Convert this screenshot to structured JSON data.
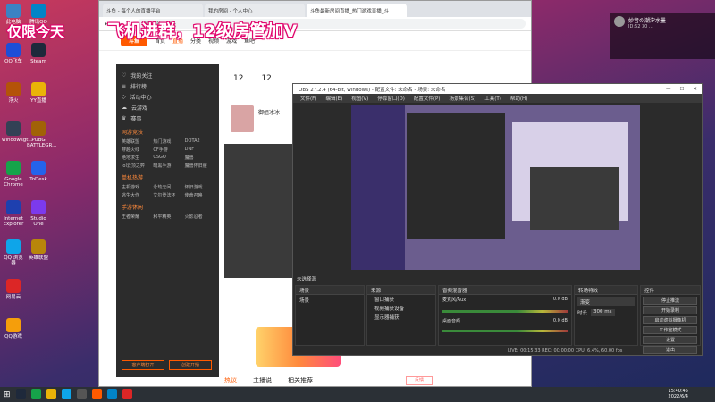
{
  "overlay": {
    "banner_left": "仅限今天",
    "banner_main": "飞机进群，12级房管加V"
  },
  "desktop_icons": [
    {
      "label": "此电脑",
      "color": "#3b82c4"
    },
    {
      "label": "QQ飞车",
      "color": "#1d4ed8"
    },
    {
      "label": "浮火",
      "color": "#b45309"
    },
    {
      "label": "windowsgt...",
      "color": "#334155"
    },
    {
      "label": "Google Chrome",
      "color": "#16a34a"
    },
    {
      "label": "Internet Explorer",
      "color": "#1e40af"
    },
    {
      "label": "QQ 浏览器",
      "color": "#0ea5e9"
    },
    {
      "label": "网易云",
      "color": "#dc2626"
    },
    {
      "label": "QQ游戏",
      "color": "#f59e0b"
    }
  ],
  "desktop_icons_col2": [
    {
      "label": "腾讯QQ",
      "color": "#0284c7"
    },
    {
      "label": "Steam",
      "color": "#1e293b"
    },
    {
      "label": "YY直播",
      "color": "#eab308"
    },
    {
      "label": "PUBG BATTLEGR...",
      "color": "#a16207"
    },
    {
      "label": "ToDesk",
      "color": "#2563eb"
    },
    {
      "label": "Studio One",
      "color": "#7c3aed"
    },
    {
      "label": "英雄联盟",
      "color": "#b8860b"
    }
  ],
  "browser": {
    "tabs": [
      "斗鱼 - 每个人的直播平台",
      "我的房间 - 个人中心",
      "斗鱼最新房间直播_热门游戏直播_斗"
    ],
    "address": "搜索或输入网址",
    "nav": [
      "首页",
      "直播",
      "分类",
      "视频",
      "游戏",
      "鱼吧"
    ],
    "logo": "斗鱼",
    "sidebar_items": [
      "我的关注",
      "排行榜",
      "活动中心",
      "云游戏",
      "赛事"
    ],
    "sidebar_section1": "网游竞技",
    "sidebar_grid1": [
      "英雄联盟",
      "热门游戏",
      "DOTA2",
      "穿越火线",
      "CF手游",
      "DNF",
      "绝地求生",
      "CSGO",
      "魔兽",
      "lol云顶之弈",
      "暗黑手游",
      "魔兽怀旧服"
    ],
    "sidebar_section2": "单机热游",
    "sidebar_grid2": [
      "主机游戏",
      "永劫无间",
      "怀旧游戏",
      "逃生大作",
      "艾尔登法环",
      "使命召唤"
    ],
    "sidebar_section3": "手游休闲",
    "sidebar_grid3": [
      "王者荣耀",
      "和平精英",
      "火影忍者"
    ],
    "sidebar_btn_left": "客户端打开",
    "sidebar_btn_right": "创建开播",
    "stat1": "12",
    "stat2": "12",
    "anchor_name": "御姐冰冰",
    "bottom_tabs": [
      "热议",
      "主播说",
      "相关推荐"
    ],
    "report_btn": "反馈"
  },
  "obs": {
    "title": "OBS 27.2.4 (64-bit, windows) - 配置文件: 未命名 - 场景: 未命名",
    "menu": [
      "文件(F)",
      "编辑(E)",
      "视图(V)",
      "停靠窗口(D)",
      "配置文件(P)",
      "场景集合(S)",
      "工具(T)",
      "帮助(H)"
    ],
    "no_source": "未选择源",
    "panels": {
      "scenes": "场景",
      "sources": "来源",
      "mixer": "音频混音器",
      "transitions": "转场特效",
      "controls": "控件"
    },
    "scene_item": "场景",
    "sources": [
      "窗口捕获",
      "视频捕获设备",
      "显示器捕获"
    ],
    "mixer_tracks": [
      {
        "name": "麦克风/Aux",
        "db": "0.0 dB"
      },
      {
        "name": "桌面音频",
        "db": "0.0 dB"
      }
    ],
    "transition": "渐变",
    "duration_label": "时长",
    "duration": "300 ms",
    "controls": [
      "停止推流",
      "开始录制",
      "启动虚拟摄像机",
      "工作室模式",
      "设置",
      "退出"
    ],
    "status": "LIVE: 00:15:33  REC: 00:00:00  CPU: 6.4%, 60.00 fps"
  },
  "chat": {
    "name": "妙音の潮汐水墨",
    "sub": "ID:62 30 ..."
  },
  "clock": {
    "time": "15:40:45",
    "date": "2022/6/4"
  }
}
